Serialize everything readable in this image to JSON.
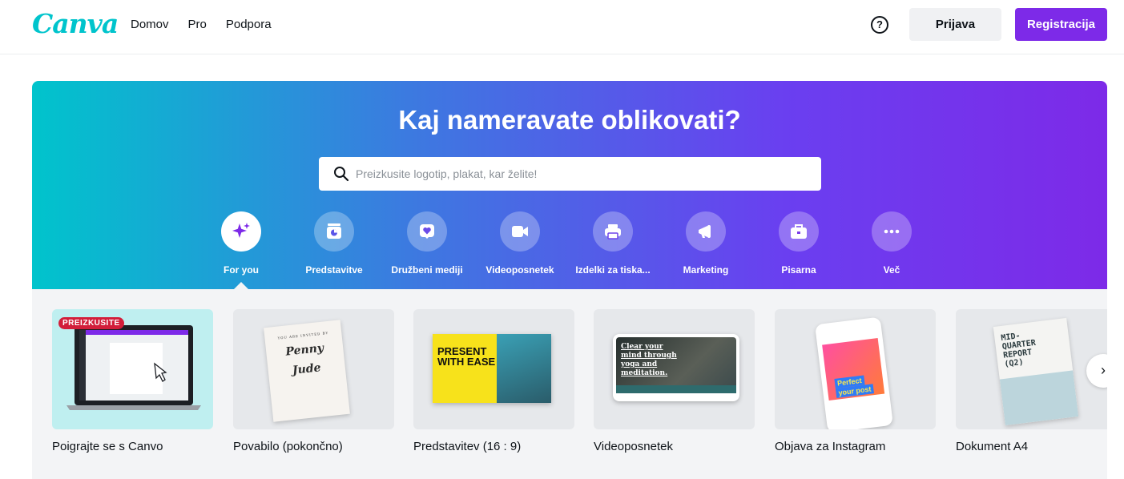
{
  "header": {
    "logo": "Canva",
    "nav": [
      "Domov",
      "Pro",
      "Podpora"
    ],
    "help_icon": "?",
    "login_label": "Prijava",
    "signup_label": "Registracija"
  },
  "hero": {
    "title": "Kaj nameravate oblikovati?",
    "search_placeholder": "Preizkusite logotip, plakat, kar želite!",
    "categories": [
      {
        "label": "For you",
        "icon": "sparkle-icon"
      },
      {
        "label": "Predstavitve",
        "icon": "presentation-icon"
      },
      {
        "label": "Družbeni mediji",
        "icon": "heart-icon"
      },
      {
        "label": "Videoposnetek",
        "icon": "video-icon"
      },
      {
        "label": "Izdelki za tiska...",
        "icon": "printer-icon"
      },
      {
        "label": "Marketing",
        "icon": "megaphone-icon"
      },
      {
        "label": "Pisarna",
        "icon": "briefcase-icon"
      },
      {
        "label": "Več",
        "icon": "more-icon"
      }
    ],
    "colors": {
      "start": "#00c4cc",
      "end": "#7d2ae8"
    }
  },
  "cards": [
    {
      "title": "Poigrajte se s Canvo",
      "badge": "PREIZKUSITE"
    },
    {
      "title": "Povabilo (pokončno)",
      "thumb_text": [
        "YOU ARE INVITED BY",
        "Penny",
        "Jude"
      ]
    },
    {
      "title": "Predstavitev (16 : 9)",
      "thumb_text": [
        "PRESENT",
        "WITH EASE"
      ]
    },
    {
      "title": "Videoposnetek",
      "thumb_text": [
        "Clear your",
        "mind through",
        "yoga and",
        "meditation."
      ]
    },
    {
      "title": "Objava za Instagram",
      "thumb_text": [
        "Perfect",
        "your post"
      ]
    },
    {
      "title": "Dokument A4",
      "thumb_text": [
        "MID-",
        "QUARTER",
        "REPORT",
        "(Q2)"
      ]
    }
  ],
  "next_arrow": "›"
}
